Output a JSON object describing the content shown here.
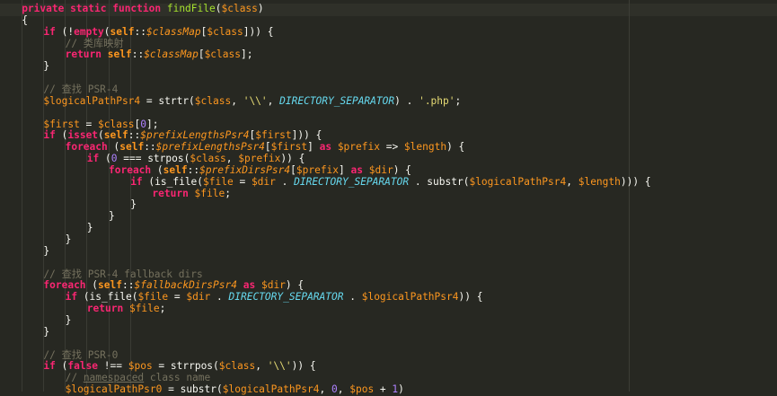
{
  "editor": {
    "language": "php",
    "theme": "monokai",
    "colors": {
      "background": "#272822",
      "keyword": "#f92672",
      "function": "#a6e22e",
      "variable": "#fd971f",
      "string": "#e6db74",
      "number": "#ae81ff",
      "constant": "#66d9ef",
      "comment": "#75715e",
      "text": "#f8f8f2"
    },
    "lines": [
      {
        "indent": 1,
        "tokens": [
          {
            "t": "kwb",
            "v": "private static function "
          },
          {
            "t": "fn",
            "v": "findFile"
          },
          {
            "t": "pl",
            "v": "("
          },
          {
            "t": "var",
            "v": "$class"
          },
          {
            "t": "pl",
            "v": ")"
          }
        ]
      },
      {
        "indent": 1,
        "tokens": [
          {
            "t": "pl",
            "v": "{"
          }
        ]
      },
      {
        "indent": 2,
        "tokens": [
          {
            "t": "kwb",
            "v": "if"
          },
          {
            "t": "pl",
            "v": " (!"
          },
          {
            "t": "kwb",
            "v": "empty"
          },
          {
            "t": "pl",
            "v": "("
          },
          {
            "t": "self",
            "v": "self"
          },
          {
            "t": "pl",
            "v": "::"
          },
          {
            "t": "ivar",
            "v": "$classMap"
          },
          {
            "t": "pl",
            "v": "["
          },
          {
            "t": "var",
            "v": "$class"
          },
          {
            "t": "pl",
            "v": "])) {"
          }
        ]
      },
      {
        "indent": 3,
        "tokens": [
          {
            "t": "cmt",
            "v": "// 类库映射"
          }
        ]
      },
      {
        "indent": 3,
        "tokens": [
          {
            "t": "kwb",
            "v": "return "
          },
          {
            "t": "self",
            "v": "self"
          },
          {
            "t": "pl",
            "v": "::"
          },
          {
            "t": "ivar",
            "v": "$classMap"
          },
          {
            "t": "pl",
            "v": "["
          },
          {
            "t": "var",
            "v": "$class"
          },
          {
            "t": "pl",
            "v": "];"
          }
        ]
      },
      {
        "indent": 2,
        "tokens": [
          {
            "t": "pl",
            "v": "}"
          }
        ]
      },
      {
        "indent": 0,
        "tokens": []
      },
      {
        "indent": 2,
        "tokens": [
          {
            "t": "cmt",
            "v": "// 查找 PSR-4"
          }
        ]
      },
      {
        "indent": 2,
        "tokens": [
          {
            "t": "var",
            "v": "$logicalPathPsr4"
          },
          {
            "t": "pl",
            "v": " = strtr("
          },
          {
            "t": "var",
            "v": "$class"
          },
          {
            "t": "pl",
            "v": ", "
          },
          {
            "t": "str",
            "v": "'\\\\'"
          },
          {
            "t": "pl",
            "v": ", "
          },
          {
            "t": "const",
            "v": "DIRECTORY_SEPARATOR"
          },
          {
            "t": "pl",
            "v": ") . "
          },
          {
            "t": "str",
            "v": "'.php'"
          },
          {
            "t": "pl",
            "v": ";"
          }
        ]
      },
      {
        "indent": 0,
        "tokens": []
      },
      {
        "indent": 2,
        "tokens": [
          {
            "t": "var",
            "v": "$first"
          },
          {
            "t": "pl",
            "v": " = "
          },
          {
            "t": "var",
            "v": "$class"
          },
          {
            "t": "pl",
            "v": "["
          },
          {
            "t": "num",
            "v": "0"
          },
          {
            "t": "pl",
            "v": "];"
          }
        ]
      },
      {
        "indent": 2,
        "tokens": [
          {
            "t": "kwb",
            "v": "if"
          },
          {
            "t": "pl",
            "v": " ("
          },
          {
            "t": "kwb",
            "v": "isset"
          },
          {
            "t": "pl",
            "v": "("
          },
          {
            "t": "self",
            "v": "self"
          },
          {
            "t": "pl",
            "v": "::"
          },
          {
            "t": "ivar",
            "v": "$prefixLengthsPsr4"
          },
          {
            "t": "pl",
            "v": "["
          },
          {
            "t": "var",
            "v": "$first"
          },
          {
            "t": "pl",
            "v": "])) {"
          }
        ]
      },
      {
        "indent": 3,
        "tokens": [
          {
            "t": "kwb",
            "v": "foreach"
          },
          {
            "t": "pl",
            "v": " ("
          },
          {
            "t": "self",
            "v": "self"
          },
          {
            "t": "pl",
            "v": "::"
          },
          {
            "t": "ivar",
            "v": "$prefixLengthsPsr4"
          },
          {
            "t": "pl",
            "v": "["
          },
          {
            "t": "var",
            "v": "$first"
          },
          {
            "t": "pl",
            "v": "] "
          },
          {
            "t": "kwb",
            "v": "as"
          },
          {
            "t": "pl",
            "v": " "
          },
          {
            "t": "var",
            "v": "$prefix"
          },
          {
            "t": "pl",
            "v": " => "
          },
          {
            "t": "var",
            "v": "$length"
          },
          {
            "t": "pl",
            "v": ") {"
          }
        ]
      },
      {
        "indent": 4,
        "tokens": [
          {
            "t": "kwb",
            "v": "if"
          },
          {
            "t": "pl",
            "v": " ("
          },
          {
            "t": "num",
            "v": "0"
          },
          {
            "t": "pl",
            "v": " === strpos("
          },
          {
            "t": "var",
            "v": "$class"
          },
          {
            "t": "pl",
            "v": ", "
          },
          {
            "t": "var",
            "v": "$prefix"
          },
          {
            "t": "pl",
            "v": ")) {"
          }
        ]
      },
      {
        "indent": 5,
        "tokens": [
          {
            "t": "kwb",
            "v": "foreach"
          },
          {
            "t": "pl",
            "v": " ("
          },
          {
            "t": "self",
            "v": "self"
          },
          {
            "t": "pl",
            "v": "::"
          },
          {
            "t": "ivar",
            "v": "$prefixDirsPsr4"
          },
          {
            "t": "pl",
            "v": "["
          },
          {
            "t": "var",
            "v": "$prefix"
          },
          {
            "t": "pl",
            "v": "] "
          },
          {
            "t": "kwb",
            "v": "as"
          },
          {
            "t": "pl",
            "v": " "
          },
          {
            "t": "var",
            "v": "$dir"
          },
          {
            "t": "pl",
            "v": ") {"
          }
        ]
      },
      {
        "indent": 6,
        "tokens": [
          {
            "t": "kwb",
            "v": "if"
          },
          {
            "t": "pl",
            "v": " (is_file("
          },
          {
            "t": "var",
            "v": "$file"
          },
          {
            "t": "pl",
            "v": " = "
          },
          {
            "t": "var",
            "v": "$dir"
          },
          {
            "t": "pl",
            "v": " . "
          },
          {
            "t": "const",
            "v": "DIRECTORY_SEPARATOR"
          },
          {
            "t": "pl",
            "v": " . substr("
          },
          {
            "t": "var",
            "v": "$logicalPathPsr4"
          },
          {
            "t": "pl",
            "v": ", "
          },
          {
            "t": "var",
            "v": "$length"
          },
          {
            "t": "pl",
            "v": "))) {"
          }
        ]
      },
      {
        "indent": 7,
        "tokens": [
          {
            "t": "kwb",
            "v": "return "
          },
          {
            "t": "var",
            "v": "$file"
          },
          {
            "t": "pl",
            "v": ";"
          }
        ]
      },
      {
        "indent": 6,
        "tokens": [
          {
            "t": "pl",
            "v": "}"
          }
        ]
      },
      {
        "indent": 5,
        "tokens": [
          {
            "t": "pl",
            "v": "}"
          }
        ]
      },
      {
        "indent": 4,
        "tokens": [
          {
            "t": "pl",
            "v": "}"
          }
        ]
      },
      {
        "indent": 3,
        "tokens": [
          {
            "t": "pl",
            "v": "}"
          }
        ]
      },
      {
        "indent": 2,
        "tokens": [
          {
            "t": "pl",
            "v": "}"
          }
        ]
      },
      {
        "indent": 0,
        "tokens": []
      },
      {
        "indent": 2,
        "tokens": [
          {
            "t": "cmt",
            "v": "// 查找 PSR-4 fallback dirs"
          }
        ]
      },
      {
        "indent": 2,
        "tokens": [
          {
            "t": "kwb",
            "v": "foreach"
          },
          {
            "t": "pl",
            "v": " ("
          },
          {
            "t": "self",
            "v": "self"
          },
          {
            "t": "pl",
            "v": "::"
          },
          {
            "t": "ivar",
            "v": "$fallbackDirsPsr4"
          },
          {
            "t": "pl",
            "v": " "
          },
          {
            "t": "kwb",
            "v": "as"
          },
          {
            "t": "pl",
            "v": " "
          },
          {
            "t": "var",
            "v": "$dir"
          },
          {
            "t": "pl",
            "v": ") {"
          }
        ]
      },
      {
        "indent": 3,
        "tokens": [
          {
            "t": "kwb",
            "v": "if"
          },
          {
            "t": "pl",
            "v": " (is_file("
          },
          {
            "t": "var",
            "v": "$file"
          },
          {
            "t": "pl",
            "v": " = "
          },
          {
            "t": "var",
            "v": "$dir"
          },
          {
            "t": "pl",
            "v": " . "
          },
          {
            "t": "const",
            "v": "DIRECTORY_SEPARATOR"
          },
          {
            "t": "pl",
            "v": " . "
          },
          {
            "t": "var",
            "v": "$logicalPathPsr4"
          },
          {
            "t": "pl",
            "v": ")) {"
          }
        ]
      },
      {
        "indent": 4,
        "tokens": [
          {
            "t": "kwb",
            "v": "return "
          },
          {
            "t": "var",
            "v": "$file"
          },
          {
            "t": "pl",
            "v": ";"
          }
        ]
      },
      {
        "indent": 3,
        "tokens": [
          {
            "t": "pl",
            "v": "}"
          }
        ]
      },
      {
        "indent": 2,
        "tokens": [
          {
            "t": "pl",
            "v": "}"
          }
        ]
      },
      {
        "indent": 0,
        "tokens": []
      },
      {
        "indent": 2,
        "tokens": [
          {
            "t": "cmt",
            "v": "// 查找 PSR-0"
          }
        ]
      },
      {
        "indent": 2,
        "tokens": [
          {
            "t": "kwb",
            "v": "if"
          },
          {
            "t": "pl",
            "v": " ("
          },
          {
            "t": "kwb",
            "v": "false"
          },
          {
            "t": "pl",
            "v": " !== "
          },
          {
            "t": "var",
            "v": "$pos"
          },
          {
            "t": "pl",
            "v": " = strrpos("
          },
          {
            "t": "var",
            "v": "$class"
          },
          {
            "t": "pl",
            "v": ", "
          },
          {
            "t": "str",
            "v": "'\\\\'"
          },
          {
            "t": "pl",
            "v": ")) {"
          }
        ]
      },
      {
        "indent": 3,
        "tokens": [
          {
            "t": "cmt",
            "v": "// "
          },
          {
            "t": "cmt-ul",
            "v": "namespaced"
          },
          {
            "t": "cmt",
            "v": " class name"
          }
        ]
      },
      {
        "indent": 3,
        "tokens": [
          {
            "t": "var",
            "v": "$logicalPathPsr0"
          },
          {
            "t": "pl",
            "v": " = substr("
          },
          {
            "t": "var",
            "v": "$logicalPathPsr4"
          },
          {
            "t": "pl",
            "v": ", "
          },
          {
            "t": "num",
            "v": "0"
          },
          {
            "t": "pl",
            "v": ", "
          },
          {
            "t": "var",
            "v": "$pos"
          },
          {
            "t": "pl",
            "v": " + "
          },
          {
            "t": "num",
            "v": "1"
          },
          {
            "t": "pl",
            "v": ")"
          }
        ]
      }
    ]
  }
}
